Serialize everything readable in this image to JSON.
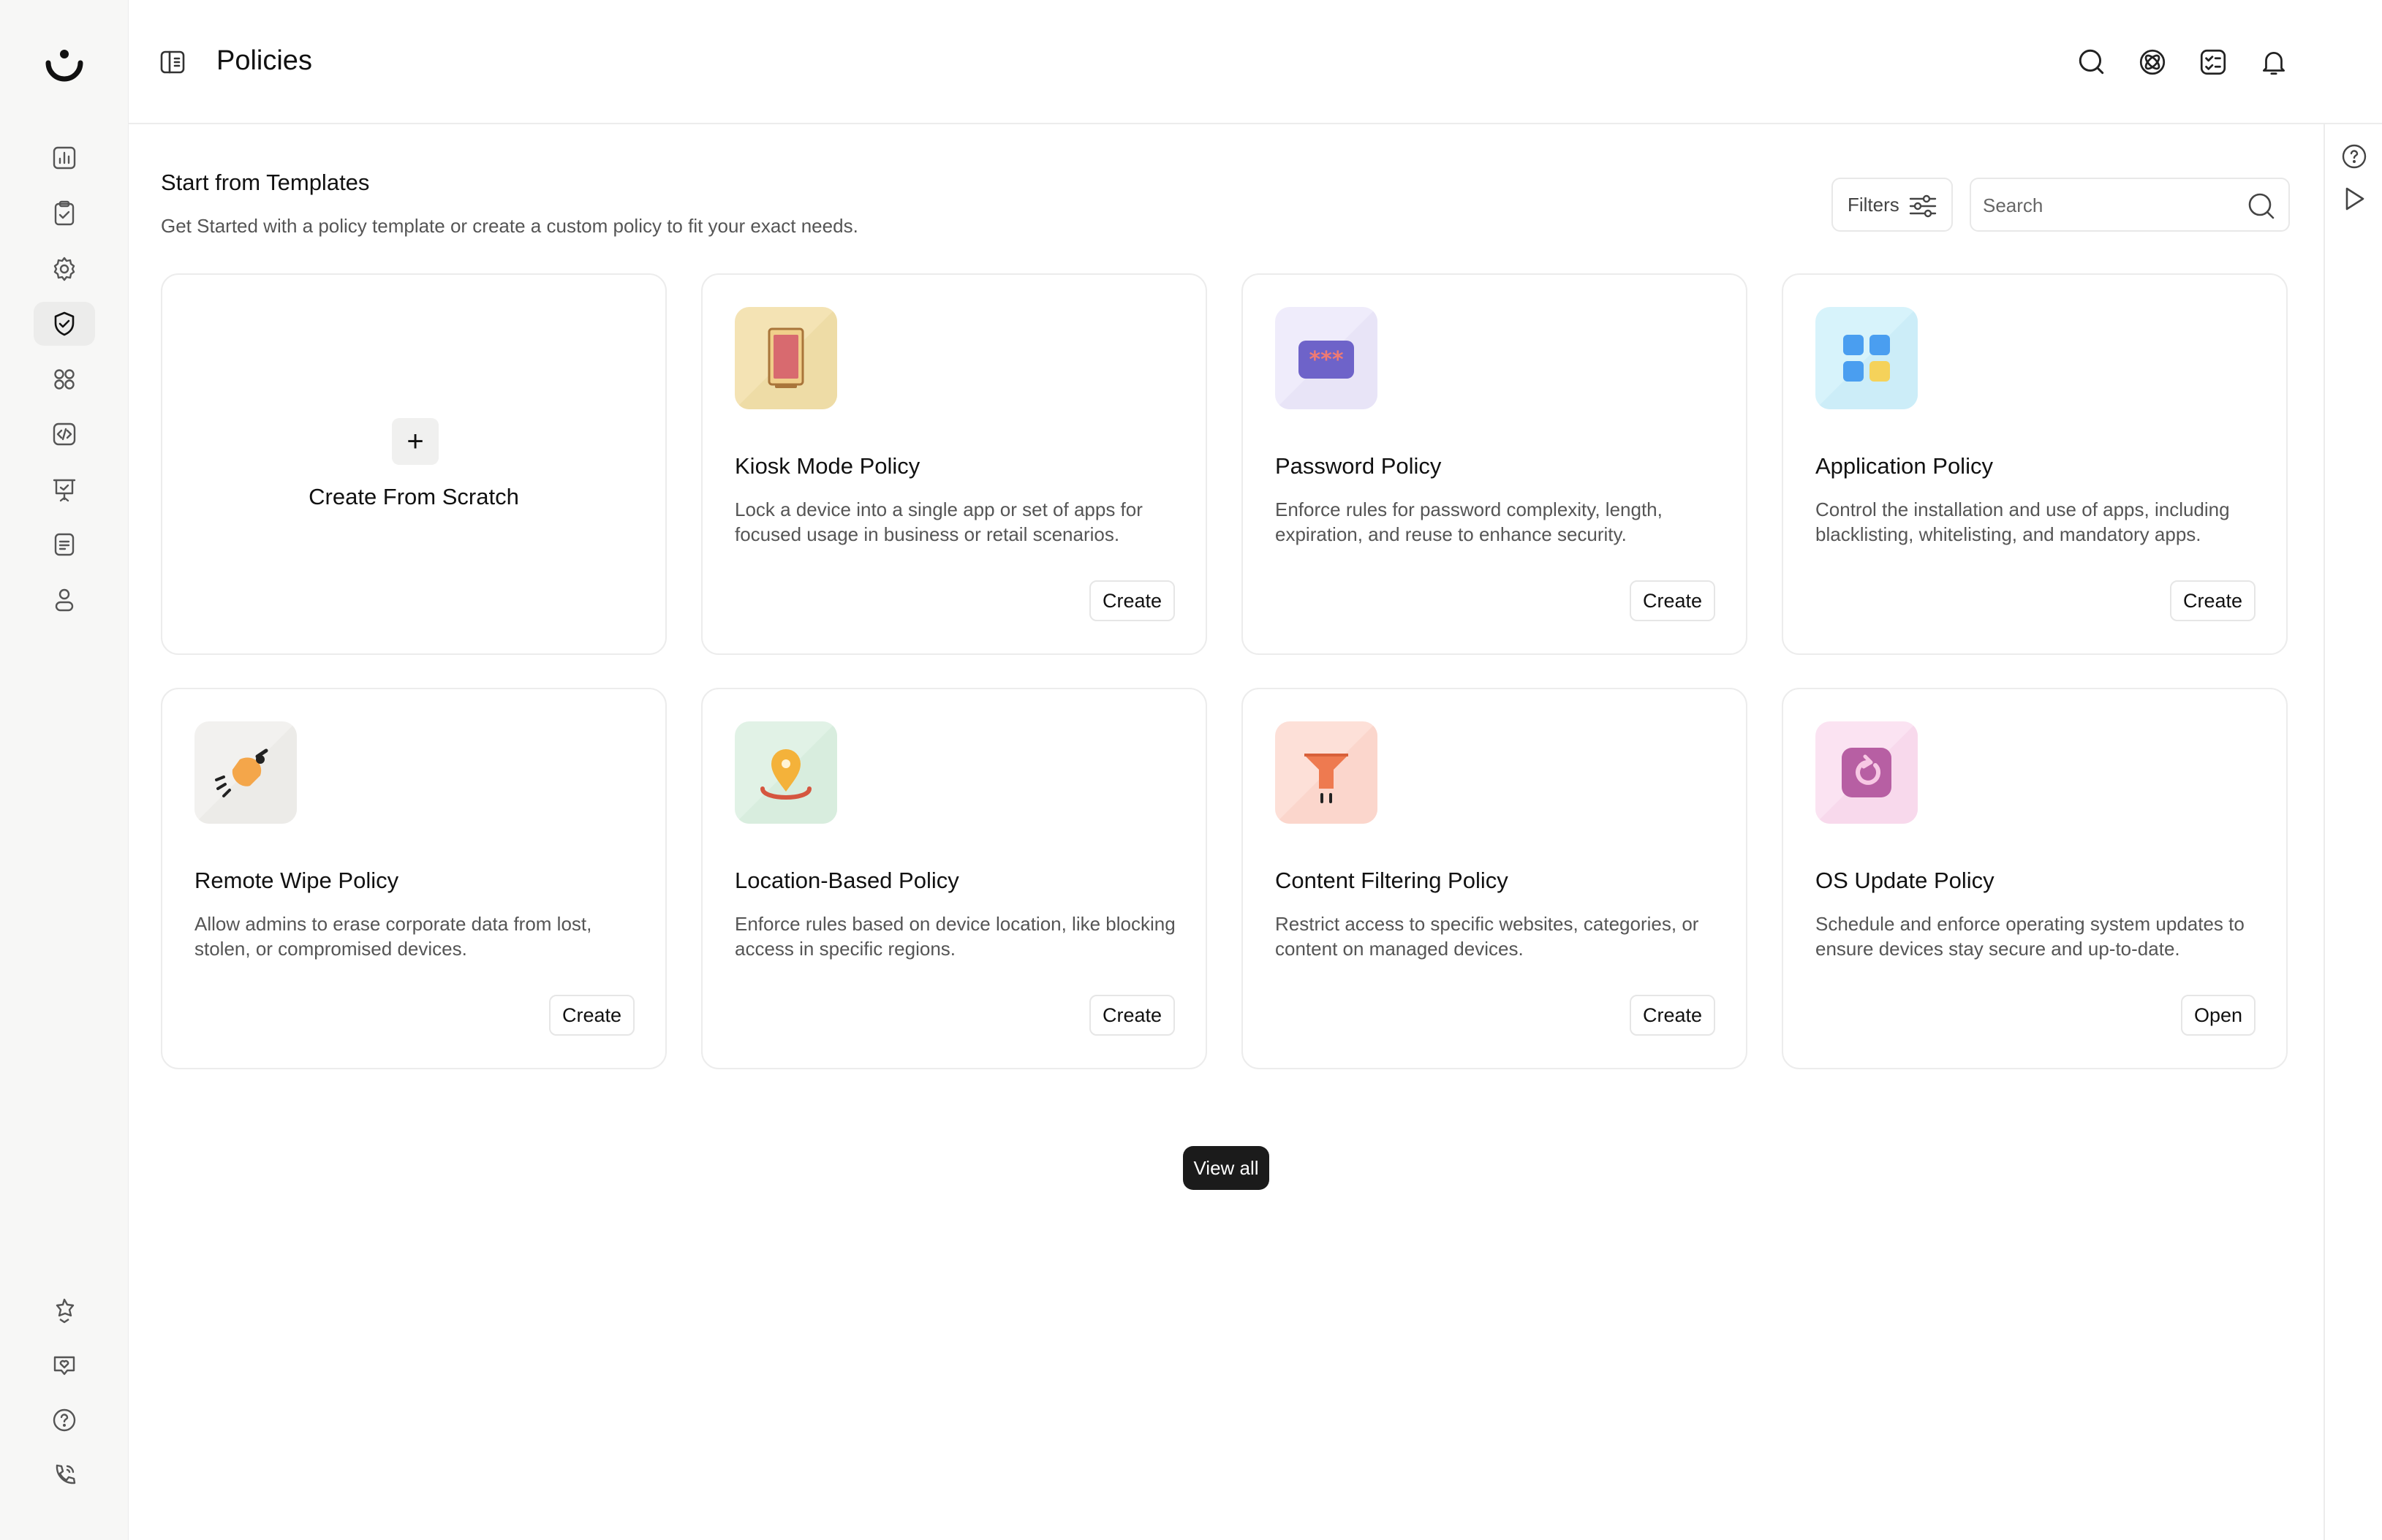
{
  "header": {
    "title": "Policies"
  },
  "main": {
    "section_title": "Start from Templates",
    "section_subtitle": "Get Started with a policy template or create a custom policy to fit your exact needs.",
    "filters_label": "Filters",
    "search_placeholder": "Search",
    "scratch_label": "Create From Scratch",
    "scratch_icon": "+",
    "view_all_label": "View all",
    "cards": [
      {
        "title": "Kiosk Mode Policy",
        "description": "Lock a device into a single app or set of apps for focused usage in business or retail scenarios.",
        "action": "Create",
        "icon": "kiosk-tablet-icon"
      },
      {
        "title": "Password Policy",
        "description": "Enforce rules for password complexity, length, expiration, and reuse to enhance security.",
        "action": "Create",
        "icon": "password-asterisks-icon"
      },
      {
        "title": "Application Policy",
        "description": "Control the installation and use of apps, including blacklisting, whitelisting, and mandatory apps.",
        "action": "Create",
        "icon": "app-grid-icon"
      },
      {
        "title": "Remote Wipe Policy",
        "description": "Allow admins to erase corporate data from lost, stolen, or compromised devices.",
        "action": "Create",
        "icon": "broom-icon"
      },
      {
        "title": "Location-Based Policy",
        "description": "Enforce rules based on device location, like blocking access in specific regions.",
        "action": "Create",
        "icon": "location-pin-icon"
      },
      {
        "title": "Content Filtering Policy",
        "description": "Restrict access to specific websites, categories, or content on managed devices.",
        "action": "Create",
        "icon": "funnel-filter-icon"
      },
      {
        "title": "OS Update Policy",
        "description": "Schedule and enforce operating system updates to ensure devices stay secure and up-to-date.",
        "action": "Open",
        "icon": "refresh-update-icon"
      }
    ]
  },
  "colors": {
    "sidebar_bg": "#f7f7f6",
    "active_nav_bg": "#ececeb",
    "view_all_bg": "#1b1b1b",
    "kiosk_tile": "#f4e3b4",
    "password_tile": "#efecfb",
    "application_tile": "#d7f3fb",
    "remote_wipe_tile": "#f2f1ef",
    "location_tile": "#e1f2e6",
    "content_filter_tile": "#fde0d8",
    "os_update_tile": "#fbe3f2"
  }
}
